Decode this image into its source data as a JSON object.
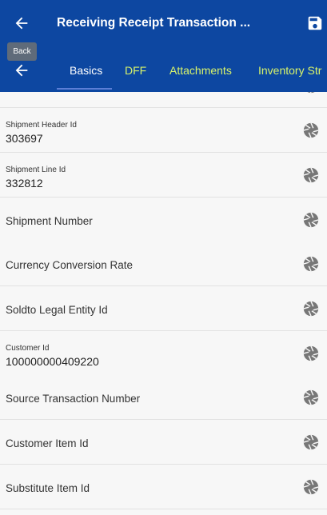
{
  "header": {
    "title": "Receiving Receipt Transaction ...",
    "back_tooltip": "Back"
  },
  "tabs": [
    {
      "label": "Basics"
    },
    {
      "label": "DFF"
    },
    {
      "label": "Attachments"
    },
    {
      "label": "Inventory Str"
    }
  ],
  "fields": [
    {
      "label": "Shipment Header Id",
      "value": "303697"
    },
    {
      "label": "Shipment Line Id",
      "value": "332812"
    },
    {
      "label": "Shipment Number",
      "value": ""
    },
    {
      "label": "Currency Conversion Rate",
      "value": ""
    },
    {
      "label": "Soldto Legal Entity Id",
      "value": ""
    },
    {
      "label": "Customer Id",
      "value": "100000000409220"
    },
    {
      "label": "Source Transaction Number",
      "value": ""
    },
    {
      "label": "Customer Item Id",
      "value": ""
    },
    {
      "label": "Substitute Item Id",
      "value": ""
    }
  ],
  "colors": {
    "header_bg": "#0d47a1",
    "tab_inactive": "#d8f36a",
    "tab_underline": "#5c7fd6"
  },
  "icons": {
    "back": "arrow-left-icon",
    "save": "save-icon",
    "field_action": "aperture-icon"
  }
}
